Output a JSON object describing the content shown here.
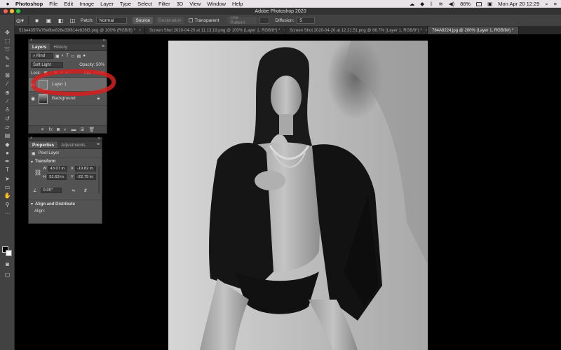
{
  "menubar": {
    "apple": "",
    "app": "Photoshop",
    "items": [
      "File",
      "Edit",
      "Image",
      "Layer",
      "Type",
      "Select",
      "Filter",
      "3D",
      "View",
      "Window",
      "Help"
    ],
    "battery": "86%",
    "datetime": "Mon Apr 20  12:29"
  },
  "titlebar": {
    "title": "Adobe Photoshop 2020"
  },
  "options": {
    "patch_label": "Patch:",
    "patch_value": "Normal",
    "source": "Source",
    "destination": "Destination",
    "transparent": "Transparent",
    "use_pattern": "Use Pattern",
    "diffusion_label": "Diffusion:",
    "diffusion_value": "5"
  },
  "tabs": [
    {
      "label": "51be435f7e76e8be826e33f814e826f3.png @ 100% (RGB/8) *",
      "close": "×"
    },
    {
      "label": "Screen Shot 2020-04-20 at 11.13.19.png @ 100% (Layer 1, RGB/8*) *",
      "close": "×"
    },
    {
      "label": "Screen Shot 2020-04-20 at 12.21.51.png @ 66.7% (Layer 1, RGB/8*) *",
      "close": "×"
    },
    {
      "label": "784A8224.jpg @ 200% (Layer 1, RGB/8#) *",
      "close": "×"
    }
  ],
  "layers_panel": {
    "tabs": [
      "Layers",
      "History"
    ],
    "filter_kind": "Kind",
    "blend_mode": "Soft Light",
    "opacity_label": "Opacity:",
    "opacity_value": "50%",
    "lock_label": "Lock:",
    "fill_label": "Fill:",
    "fill_value": "100%",
    "layers": [
      {
        "name": "Layer 1",
        "selected": true
      },
      {
        "name": "Background",
        "selected": false
      }
    ]
  },
  "properties_panel": {
    "tabs": [
      "Properties",
      "Adjustments"
    ],
    "layer_type": "Pixel Layer",
    "transform_label": "Transform",
    "w_label": "W",
    "w_value": "43.07 in",
    "x_label": "X",
    "x_value": "-19.82 in",
    "h_label": "H",
    "h_value": "51.63 in",
    "y_label": "Y",
    "y_value": "-22.75 in",
    "angle_value": "0.00°",
    "align_label": "Align and Distribute",
    "align_sub": "Align:"
  },
  "colors": {
    "annotation": "#d81e1e",
    "menubar_bg": "#e7e3e6",
    "panel_bg": "#535353"
  }
}
